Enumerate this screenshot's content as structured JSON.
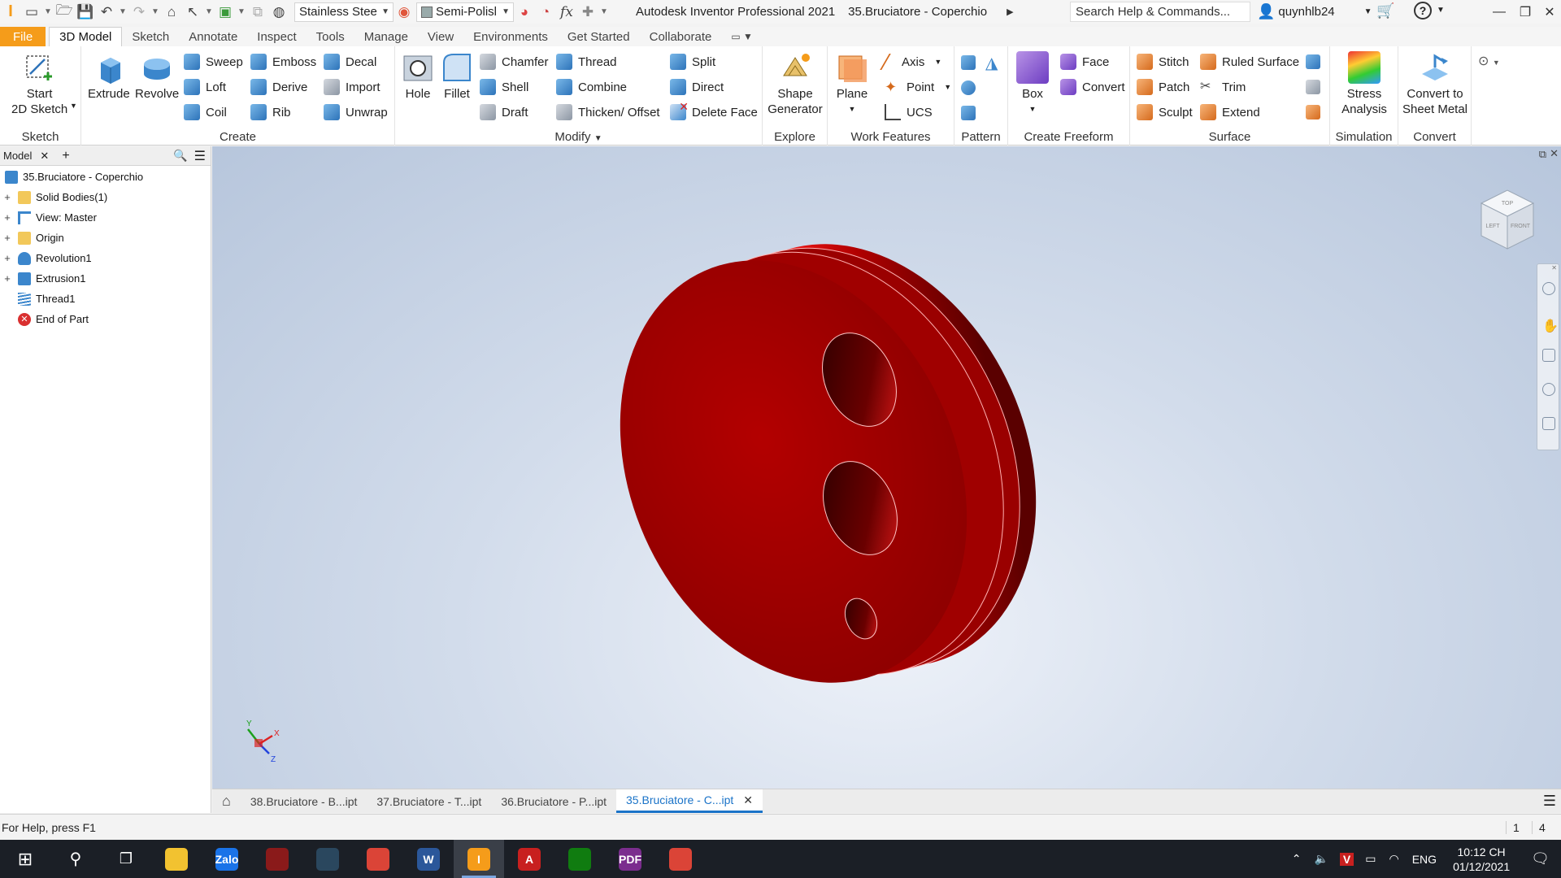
{
  "titlebar": {
    "material": "Stainless Stee",
    "appearance": "Semi-Polisl",
    "app_title": "Autodesk Inventor Professional 2021",
    "doc_title": "35.Bruciatore - Coperchio",
    "search_text": "Search Help & Commands...",
    "username": "quynhlb24"
  },
  "tabs": [
    "File",
    "3D Model",
    "Sketch",
    "Annotate",
    "Inspect",
    "Tools",
    "Manage",
    "View",
    "Environments",
    "Get Started",
    "Collaborate"
  ],
  "ribbon": {
    "sketch": {
      "label": "Sketch",
      "start": "Start",
      "start2": "2D Sketch"
    },
    "create": {
      "label": "Create",
      "extrude": "Extrude",
      "revolve": "Revolve",
      "sweep": "Sweep",
      "loft": "Loft",
      "coil": "Coil",
      "emboss": "Emboss",
      "derive": "Derive",
      "rib": "Rib",
      "decal": "Decal",
      "import": "Import",
      "unwrap": "Unwrap"
    },
    "modify": {
      "label": "Modify",
      "hole": "Hole",
      "fillet": "Fillet",
      "chamfer": "Chamfer",
      "shell": "Shell",
      "draft": "Draft",
      "thread": "Thread",
      "combine": "Combine",
      "thicken": "Thicken/ Offset",
      "split": "Split",
      "direct": "Direct",
      "delete_face": "Delete Face"
    },
    "explore": {
      "label": "Explore",
      "shape1": "Shape",
      "shape2": "Generator"
    },
    "work": {
      "label": "Work Features",
      "plane": "Plane",
      "axis": "Axis",
      "point": "Point",
      "ucs": "UCS"
    },
    "pattern": {
      "label": "Pattern"
    },
    "freeform": {
      "label": "Create Freeform",
      "box": "Box",
      "face": "Face",
      "convert": "Convert"
    },
    "surface": {
      "label": "Surface",
      "stitch": "Stitch",
      "patch": "Patch",
      "sculpt": "Sculpt",
      "ruled": "Ruled Surface",
      "trim": "Trim",
      "extend": "Extend"
    },
    "simulation": {
      "label": "Simulation",
      "stress1": "Stress",
      "stress2": "Analysis"
    },
    "convert": {
      "label": "Convert",
      "c1": "Convert to",
      "c2": "Sheet Metal"
    }
  },
  "browser": {
    "tab": "Model",
    "root": "35.Bruciatore - Coperchio",
    "items": [
      {
        "label": "Solid Bodies(1)",
        "expandable": true
      },
      {
        "label": "View: Master",
        "expandable": true
      },
      {
        "label": "Origin",
        "expandable": true
      },
      {
        "label": "Revolution1",
        "expandable": true
      },
      {
        "label": "Extrusion1",
        "expandable": true
      },
      {
        "label": "Thread1",
        "expandable": false
      },
      {
        "label": "End of Part",
        "expandable": false
      }
    ]
  },
  "viewcube": {
    "top": "TOP",
    "left": "LEFT",
    "front": "FRONT"
  },
  "triad": {
    "x": "X",
    "y": "Y",
    "z": "Z"
  },
  "doctabs": [
    "38.Bruciatore - B...ipt",
    "37.Bruciatore - T...ipt",
    "36.Bruciatore - P...ipt",
    "35.Bruciatore - C...ipt"
  ],
  "status": {
    "help": "For Help, press F1",
    "count1": "1",
    "count2": "4"
  },
  "taskbar": {
    "apps": [
      {
        "name": "file-explorer",
        "label": "",
        "color": "#f2c230"
      },
      {
        "name": "zalo",
        "label": "Zalo",
        "color": "#1a73e8"
      },
      {
        "name": "game",
        "label": "",
        "color": "#8a1a1a"
      },
      {
        "name": "steam",
        "label": "",
        "color": "#2a475e"
      },
      {
        "name": "chrome",
        "label": "",
        "color": "#db4437"
      },
      {
        "name": "word",
        "label": "W",
        "color": "#2b579a"
      },
      {
        "name": "inventor",
        "label": "I",
        "color": "#f59c1a"
      },
      {
        "name": "autocad",
        "label": "A",
        "color": "#c8201f"
      },
      {
        "name": "xbox",
        "label": "",
        "color": "#107c10"
      },
      {
        "name": "pdf",
        "label": "PDF",
        "color": "#7b2d8e"
      },
      {
        "name": "chrome-2",
        "label": "",
        "color": "#db4437"
      }
    ],
    "lang": "ENG",
    "time": "10:12 CH",
    "date": "01/12/2021"
  }
}
